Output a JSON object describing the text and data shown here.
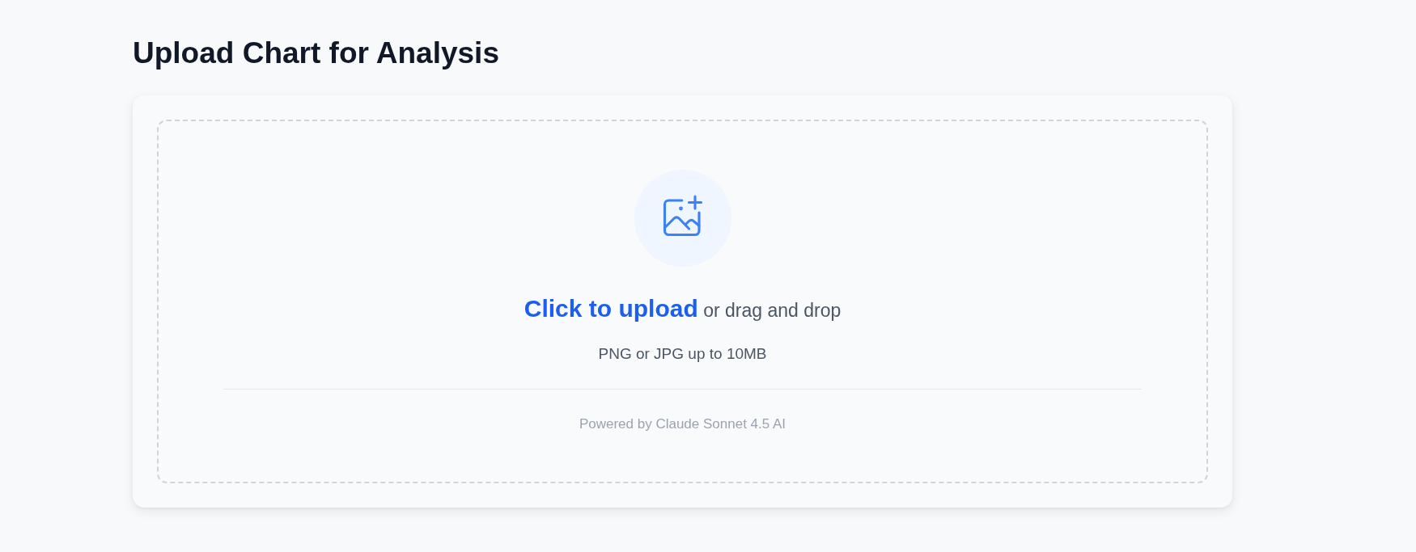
{
  "page": {
    "title": "Upload Chart for Analysis"
  },
  "dropzone": {
    "link": "Click to upload",
    "prompt": "or drag and drop",
    "hint": "PNG or JPG up to 10MB",
    "footer": "Powered by Claude Sonnet 4.5 AI"
  }
}
